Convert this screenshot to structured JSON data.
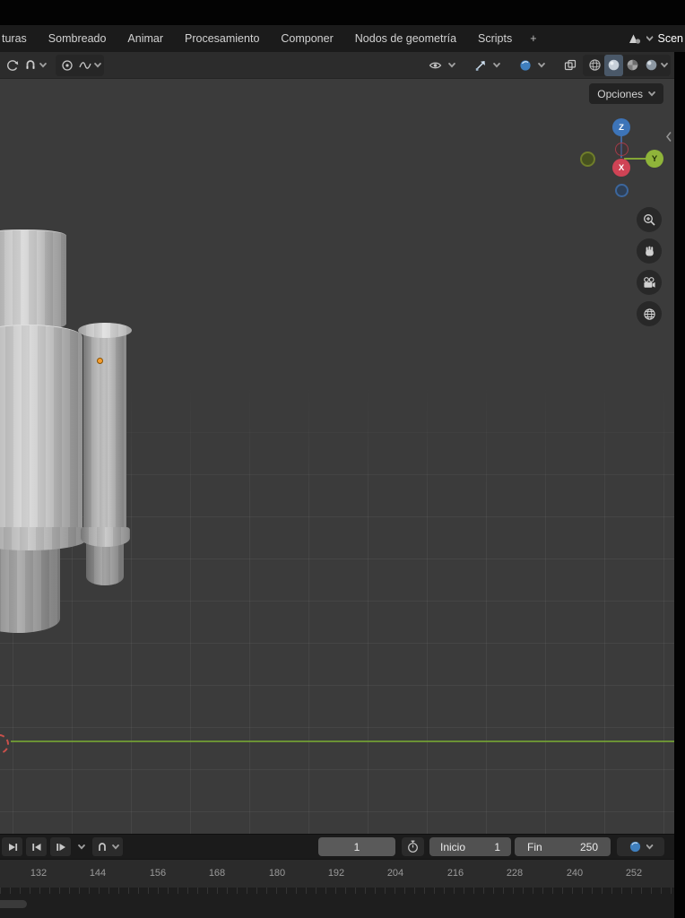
{
  "menubar": {
    "tabs": [
      "turas",
      "Sombreado",
      "Animar",
      "Procesamiento",
      "Componer",
      "Nodos de geometría",
      "Scripts",
      "+"
    ],
    "scene_label": "Scen"
  },
  "viewport": {
    "options_button_label": "Opciones",
    "axis_gizmo": {
      "x_label": "X",
      "y_label": "Y",
      "z_label": "Z"
    }
  },
  "timeline": {
    "current_frame": "1",
    "start_field": {
      "label": "Inicio",
      "value": "1"
    },
    "end_field": {
      "label": "Fin",
      "value": "250"
    },
    "ruler_ticks": [
      "132",
      "144",
      "156",
      "168",
      "180",
      "192",
      "204",
      "216",
      "228",
      "240",
      "252"
    ]
  },
  "icons": {
    "scene-icon": "cone and sphere",
    "orientation-icon": "circular arrow",
    "snap-icon": "magnet",
    "proportional-edit-icon": "circle with dot",
    "falloff-icon": "sine curve",
    "visibility-eye-icon": "eye",
    "gizmos-icon": "diagonal arrow",
    "overlays-icon": "blue sphere",
    "xray-icon": "overlapping squares",
    "shading-wireframe-icon": "wire sphere",
    "shading-solid-icon": "solid sphere",
    "shading-material-icon": "material sphere",
    "shading-rendered-icon": "rendered sphere",
    "zoom-icon": "magnifier",
    "pan-icon": "hand",
    "camera-icon": "movie camera",
    "grid-icon": "globe grid",
    "stopwatch-icon": "stopwatch",
    "world-icon": "blue globe"
  },
  "colors": {
    "accent_blue": "#4772b3",
    "axis_x_red": "#cf4355",
    "axis_y_green": "#8fb43a",
    "axis_z_blue": "#3d74b8",
    "axis_line_green": "#74a235",
    "origin_orange": "#f59d2e",
    "viewport_bg": "#3b3b3b",
    "header_bg": "#2c2c2c",
    "menubar_bg": "#1b1b1b"
  }
}
